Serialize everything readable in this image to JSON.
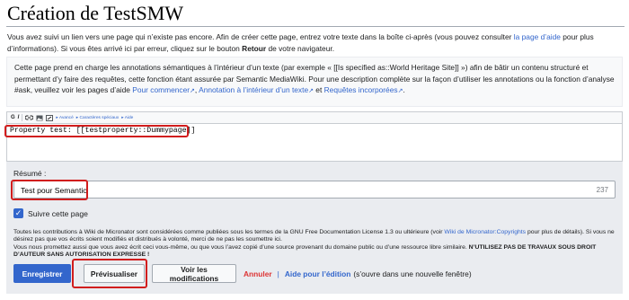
{
  "page": {
    "title": "Création de TestSMW"
  },
  "intro": {
    "text_before": "Vous avez suivi un lien vers une page qui n’existe pas encore. Afin de créer cette page, entrez votre texte dans la boîte ci-après (vous pouvez consulter ",
    "help_link": "la page d’aide",
    "text_middle": " pour plus d’informations). Si vous êtes arrivé ici par erreur, cliquez sur le bouton ",
    "back_bold": "Retour",
    "text_after": " de votre navigateur."
  },
  "notice": {
    "text_before": "Cette page prend en charge les annotations sémantiques à l’intérieur d’un texte (par exemple « [[Is specified as::World Heritage Site]] ») afin de bâtir un contenu structuré et permettant d’y faire des requêtes, cette fonction étant assurée par Semantic MediaWiki. Pour une description complète sur la façon d’utiliser les annotations ou la fonction d’analyse #ask, veuillez voir les pages d’aide ",
    "link1": "Pour commencer",
    "sep1": ", ",
    "link2": "Annotation à l’intérieur d’un texte",
    "sep2": " et ",
    "link3": "Requêtes incorporées",
    "end": "."
  },
  "toolbar": {
    "bold": "G",
    "italic": "I",
    "advanced": "Avancé",
    "special_chars": "Caractères spéciaux",
    "help": "Aide"
  },
  "editor": {
    "content": "Property test:  [[testproperty::Dummypage]]"
  },
  "summary": {
    "label": "Résumé :",
    "value": "Test pour Semantic",
    "remaining": "237"
  },
  "watch": {
    "label": "Suivre cette page",
    "checked": true
  },
  "license": {
    "text1": "Toutes les contributions à Wiki de Micronator sont considérées comme publiées sous les termes de la GNU Free Documentation License 1.3 ou ultérieure (voir ",
    "link": "Wiki de Micronator:Copyrights",
    "text2": " pour plus de détails). Si vous ne désirez pas que vos écrits soient modifiés et distribués à volonté, merci de ne pas les soumettre ici.",
    "text3": "Vous nous promettez aussi que vous avez écrit ceci vous-même, ou que vous l’avez copié d’une source provenant du domaine public ou d’une ressource libre similaire. ",
    "bold": "N’UTILISEZ PAS DE TRAVAUX SOUS DROIT D’AUTEUR SANS AUTORISATION EXPRESSE !"
  },
  "actions": {
    "save": "Enregistrer",
    "preview": "Prévisualiser",
    "show_changes": "Voir les modifications",
    "cancel": "Annuler",
    "separator": "|",
    "edit_help": "Aide pour l’édition",
    "edit_help_note": "(s’ouvre dans une nouvelle fenêtre)"
  },
  "colors": {
    "accent": "#3366cc",
    "highlight": "#d11d1d",
    "cancel": "#dd3333"
  }
}
